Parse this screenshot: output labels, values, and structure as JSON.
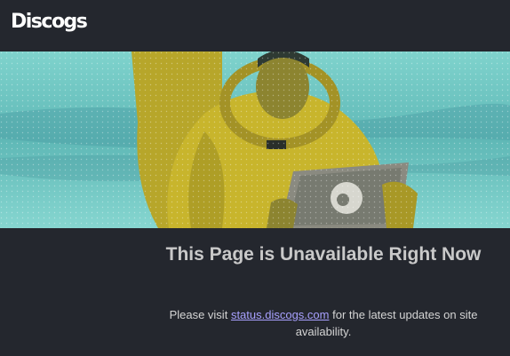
{
  "header": {
    "logo_text": "Discogs"
  },
  "hero": {
    "image_icon": "astronaut-with-tablet-illustration"
  },
  "main": {
    "title": "This Page is Unavailable Right Now",
    "message_prefix": "Please visit ",
    "status_link": "status.discogs.com",
    "message_suffix": " for the latest updates on site availability."
  },
  "colors": {
    "background": "#24272e",
    "hero_teal": "#6fc9c4",
    "hero_yellow": "#c8b52c",
    "title": "#c9c9c9",
    "link": "#a8a1ff"
  }
}
